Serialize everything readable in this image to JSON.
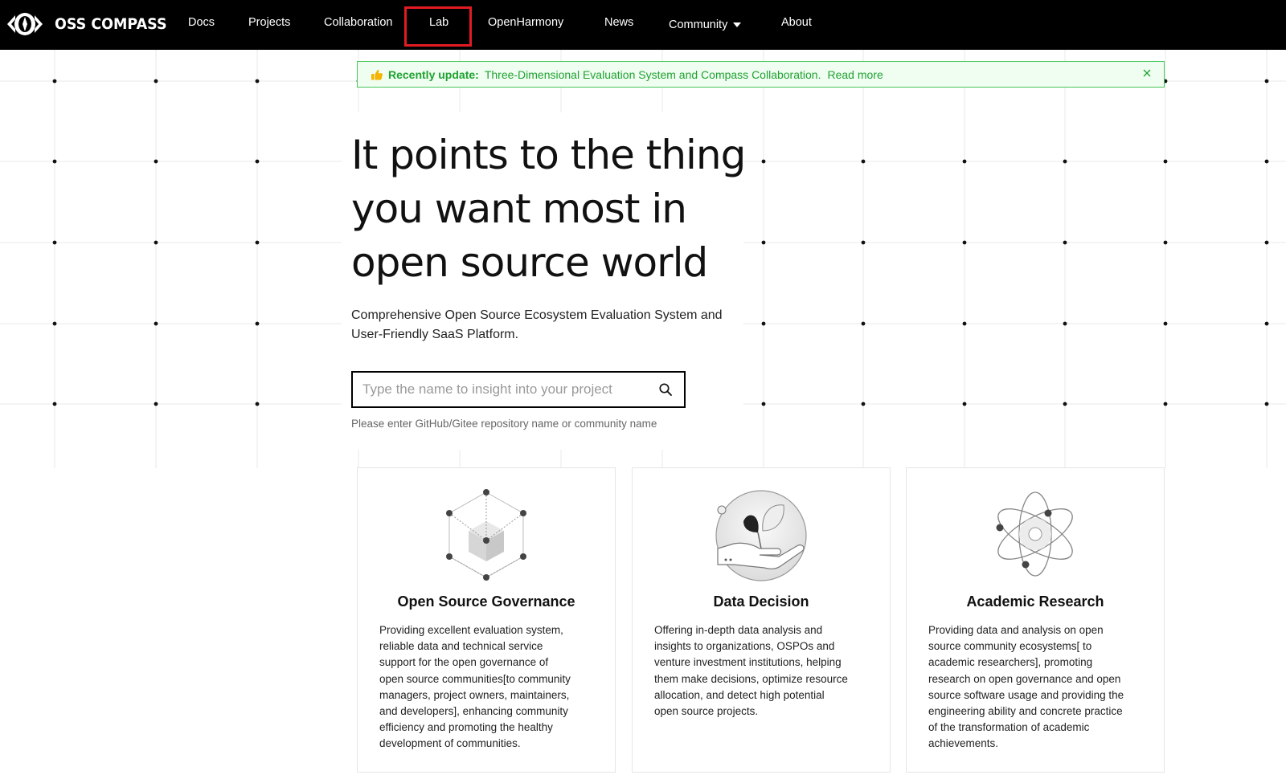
{
  "brand": {
    "name": "OSS COMPASS",
    "logo_icon": "eye-compass-logo"
  },
  "nav": {
    "items": [
      {
        "label": "Docs"
      },
      {
        "label": "Projects"
      },
      {
        "label": "Collaboration"
      },
      {
        "label": "Lab"
      },
      {
        "label": "OpenHarmony"
      },
      {
        "label": "News"
      },
      {
        "label": "Community",
        "icon": "caret-down-icon"
      },
      {
        "label": "About"
      }
    ],
    "highlighted": "Lab",
    "highlight_color": "#e31b23"
  },
  "banner": {
    "icon": "thumbs-up-icon",
    "label": "Recently update:",
    "text": "Three-Dimensional Evaluation System and Compass Collaboration.",
    "link": "Read more",
    "close_icon": "close-icon",
    "color": "#1fa332",
    "background": "#f0fdf1"
  },
  "hero": {
    "title_lines": [
      "It points to the thing",
      "you want most in",
      "open source world"
    ],
    "subtitle_lines": [
      "Comprehensive Open Source Ecosystem Evaluation System and",
      "User-Friendly SaaS Platform."
    ]
  },
  "search": {
    "placeholder": "Type the name to insight into your project",
    "value": "",
    "icon": "search-icon",
    "hint": "Please enter GitHub/Gitee repository name or community name"
  },
  "cards": [
    {
      "title": "Open Source Governance",
      "icon": "cube-network-icon",
      "lines": [
        "Providing excellent evaluation system,",
        "reliable data and technical service",
        "support for the open governance of",
        "open source communities[to community",
        "managers, project owners, maintainers,",
        "and developers], enhancing community",
        "efficiency and promoting the healthy",
        "development of communities."
      ]
    },
    {
      "title": "Data Decision",
      "icon": "hand-sprout-icon",
      "lines": [
        "Offering in-depth data analysis and",
        "insights to organizations, OSPOs and",
        "venture investment institutions, helping",
        "them make decisions, optimize resource",
        "allocation, and detect high potential",
        "open source projects."
      ]
    },
    {
      "title": "Academic Research",
      "icon": "atom-icon",
      "lines": [
        "Providing data and analysis on open",
        "source community ecosystems[ to",
        "academic researchers], promoting",
        "research on open governance and open",
        "source software usage and providing the",
        "engineering ability and concrete practice",
        "of the transformation of academic",
        "achievements."
      ]
    }
  ]
}
